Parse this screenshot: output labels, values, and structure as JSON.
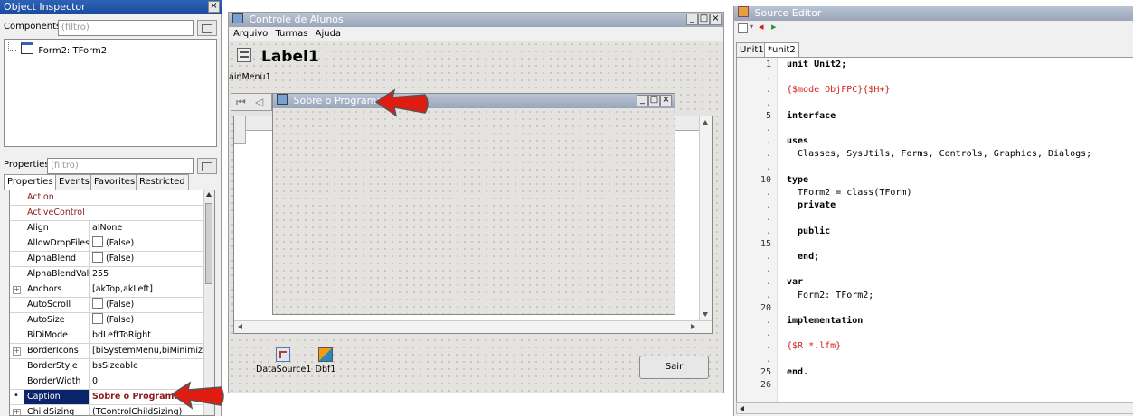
{
  "object_inspector": {
    "title": "Object Inspector",
    "components_label": "Components",
    "components_filter": "(filtro)",
    "tree_item": "Form2: TForm2",
    "properties_label": "Properties",
    "properties_filter": "(filtro)",
    "tabs": [
      "Properties",
      "Events",
      "Favorites",
      "Restricted"
    ],
    "rows": [
      {
        "name": "Action",
        "value": "",
        "expandable": false,
        "checkbox": false
      },
      {
        "name": "ActiveControl",
        "value": "",
        "expandable": false,
        "checkbox": false
      },
      {
        "name": "Align",
        "value": "alNone",
        "expandable": false,
        "checkbox": false
      },
      {
        "name": "AllowDropFiles",
        "value": "(False)",
        "expandable": false,
        "checkbox": true
      },
      {
        "name": "AlphaBlend",
        "value": "(False)",
        "expandable": false,
        "checkbox": true
      },
      {
        "name": "AlphaBlendValu",
        "value": "255",
        "expandable": false,
        "checkbox": false
      },
      {
        "name": "Anchors",
        "value": "[akTop,akLeft]",
        "expandable": true,
        "checkbox": false
      },
      {
        "name": "AutoScroll",
        "value": "(False)",
        "expandable": false,
        "checkbox": true
      },
      {
        "name": "AutoSize",
        "value": "(False)",
        "expandable": false,
        "checkbox": true
      },
      {
        "name": "BiDiMode",
        "value": "bdLeftToRight",
        "expandable": false,
        "checkbox": false
      },
      {
        "name": "BorderIcons",
        "value": "[biSystemMenu,biMinimize,biMax",
        "expandable": true,
        "checkbox": false
      },
      {
        "name": "BorderStyle",
        "value": "bsSizeable",
        "expandable": false,
        "checkbox": false
      },
      {
        "name": "BorderWidth",
        "value": "0",
        "expandable": false,
        "checkbox": false
      },
      {
        "name": "Caption",
        "value": "Sobre o Programa",
        "expandable": false,
        "checkbox": false,
        "selected": true
      },
      {
        "name": "ChildSizing",
        "value": "(TControlChildSizing)",
        "expandable": true,
        "checkbox": false
      }
    ]
  },
  "form_designer": {
    "title": "Controle de Alunos",
    "menu": [
      "Arquivo",
      "Turmas",
      "Ajuda"
    ],
    "label_caption": "Label1",
    "main_menu_caption": "ainMenu1",
    "child_form_title": "Sobre o Programa",
    "components": [
      {
        "caption": "DataSource1",
        "icon": "datasource-icon"
      },
      {
        "caption": "Dbf1",
        "icon": "dbf-icon"
      }
    ],
    "button_caption": "Sair"
  },
  "source_editor": {
    "title": "Source Editor",
    "tabs": [
      "Unit1",
      "*unit2"
    ],
    "active_tab": 1,
    "lines": [
      {
        "num": "1",
        "text": "unit Unit2;",
        "style": "kwfirst"
      },
      {
        "num": ".",
        "text": "",
        "style": "plain"
      },
      {
        "num": ".",
        "text": "{$mode ObjFPC}{$H+}",
        "style": "dir"
      },
      {
        "num": ".",
        "text": "",
        "style": "plain"
      },
      {
        "num": "5",
        "text": "interface",
        "style": "kw"
      },
      {
        "num": ".",
        "text": "",
        "style": "plain"
      },
      {
        "num": ".",
        "text": "uses",
        "style": "kw"
      },
      {
        "num": ".",
        "text": "  Classes, SysUtils, Forms, Controls, Graphics, Dialogs;",
        "style": "plain"
      },
      {
        "num": ".",
        "text": "",
        "style": "plain"
      },
      {
        "num": "10",
        "text": "type",
        "style": "kw"
      },
      {
        "num": ".",
        "text": "  TForm2 = class(TForm)",
        "style": "classline"
      },
      {
        "num": ".",
        "text": "  private",
        "style": "kw"
      },
      {
        "num": ".",
        "text": "",
        "style": "plain"
      },
      {
        "num": ".",
        "text": "  public",
        "style": "kw"
      },
      {
        "num": "15",
        "text": "",
        "style": "plain"
      },
      {
        "num": ".",
        "text": "  end;",
        "style": "kwsemi"
      },
      {
        "num": ".",
        "text": "",
        "style": "plain"
      },
      {
        "num": ".",
        "text": "var",
        "style": "kw"
      },
      {
        "num": ".",
        "text": "  Form2: TForm2;",
        "style": "plain"
      },
      {
        "num": "20",
        "text": "",
        "style": "plain"
      },
      {
        "num": ".",
        "text": "implementation",
        "style": "kw"
      },
      {
        "num": ".",
        "text": "",
        "style": "plain"
      },
      {
        "num": ".",
        "text": "{$R *.lfm}",
        "style": "dir"
      },
      {
        "num": ".",
        "text": "",
        "style": "plain"
      },
      {
        "num": "25",
        "text": "end.",
        "style": "kwdot"
      },
      {
        "num": "26",
        "text": "",
        "style": "plain"
      }
    ]
  },
  "colors": {
    "title_active": "#2e63b8",
    "selected_row": "#0a246a",
    "directive": "#d0201a",
    "arrow": "#e01b10"
  }
}
